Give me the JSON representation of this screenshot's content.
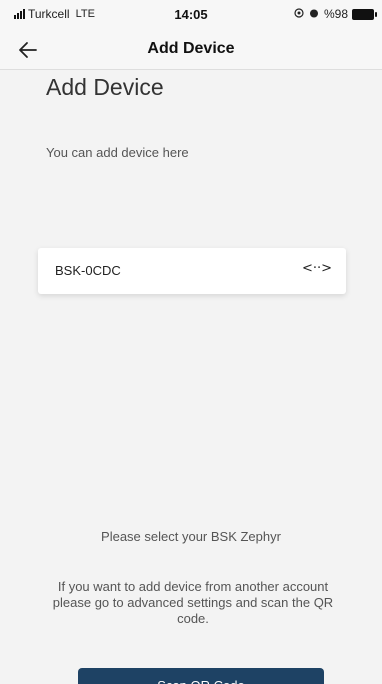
{
  "status_bar": {
    "carrier": "Turkcell",
    "network": "LTE",
    "time": "14:05",
    "battery": "%98",
    "icons": [
      "signal-icon",
      "location-icon",
      "alarm-icon",
      "battery-icon"
    ]
  },
  "header": {
    "title": "Add Device",
    "back_icon": "back-arrow-icon"
  },
  "main": {
    "title": "Add Device",
    "subtitle": "You can add device here",
    "devices": [
      {
        "name": "BSK-0CDC",
        "icon": "connect-icon",
        "icon_glyph": "<··>"
      }
    ],
    "select_prompt": "Please select your BSK Zephyr",
    "info": "If you want to add device from another account please go to advanced settings and scan the QR code.",
    "button_label": "Scan QR Code"
  },
  "colors": {
    "background": "#f3f3f3",
    "button": "#1e4264",
    "card": "#ffffff"
  }
}
